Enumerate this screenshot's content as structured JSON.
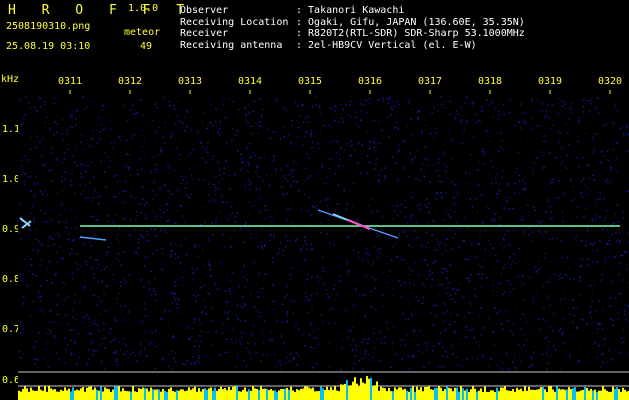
{
  "header": {
    "app_name": "H R O F F T",
    "version": "1.0.0",
    "filename": "2508190310.png",
    "meteor_label": "meteor",
    "datetime": "25.08.19 03:10",
    "meteor_count": "49"
  },
  "info": [
    {
      "key": "Observer",
      "value": ": Takanori Kawachi"
    },
    {
      "key": "Receiving Location",
      "value": ": Ogaki, Gifu, JAPAN (136.60E, 35.35N)"
    },
    {
      "key": "Receiver",
      "value": ": R820T2(RTL-SDR) SDR-Sharp 53.1000MHz"
    },
    {
      "key": "Receiving antenna",
      "value": ": 2el-HB9CV Vertical (el. E-W)"
    }
  ],
  "spectrogram": {
    "unit_label": "kHz",
    "time_labels": [
      "0311",
      "0312",
      "0313",
      "0314",
      "0315",
      "0316",
      "0317",
      "0318",
      "0319",
      "0320"
    ],
    "freq_labels": [
      "1.1",
      "1.0",
      "0.9",
      "0.8",
      "0.7",
      "0.6"
    ],
    "colors": {
      "label": "#ffff3a",
      "carrier": "#7fffb0",
      "noise": "#0a0a66",
      "level": "#ffff00",
      "text": "#ffffff"
    }
  }
}
